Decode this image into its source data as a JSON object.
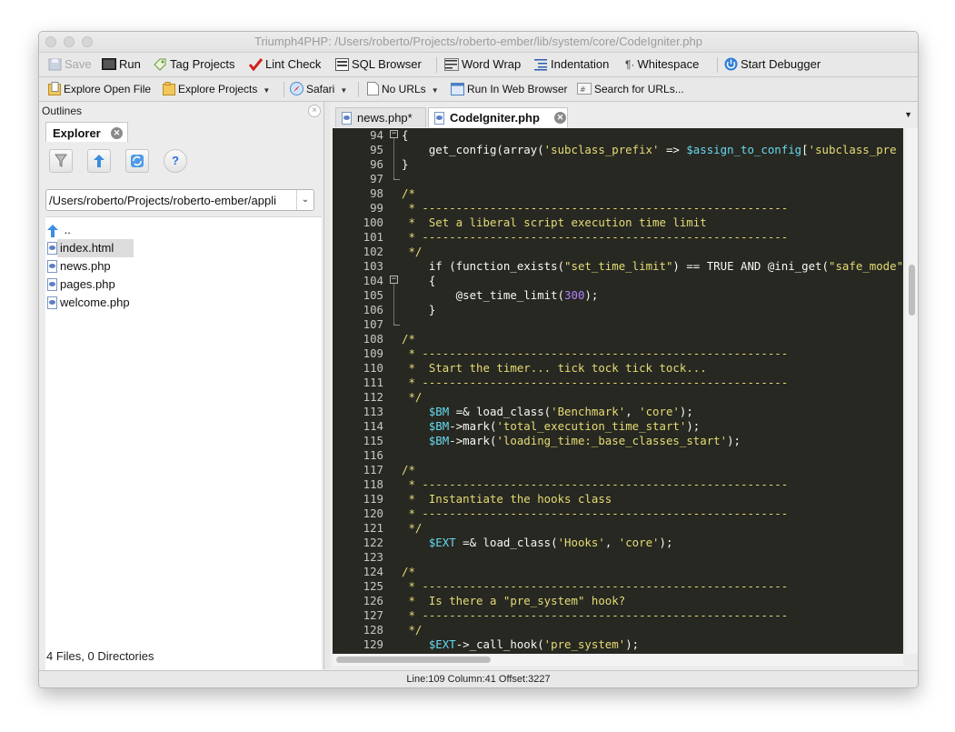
{
  "window": {
    "title": "Triumph4PHP: /Users/roberto/Projects/roberto-ember/lib/system/core/CodeIgniter.php"
  },
  "toolbar1": {
    "save": "Save",
    "run": "Run",
    "tag_projects": "Tag Projects",
    "lint_check": "Lint Check",
    "sql_browser": "SQL Browser",
    "word_wrap": "Word Wrap",
    "indentation": "Indentation",
    "whitespace": "Whitespace",
    "start_debugger": "Start Debugger"
  },
  "toolbar2": {
    "explore_open_file": "Explore Open File",
    "explore_projects": "Explore Projects",
    "browser": "Safari",
    "no_urls": "No URLs",
    "run_in_web_browser": "Run In Web Browser",
    "search_for_urls": "Search for URLs..."
  },
  "left_panel": {
    "header": "Outlines",
    "tab": "Explorer",
    "path": "/Users/roberto/Projects/roberto-ember/appli",
    "parent_dir": "..",
    "files": [
      "index.html",
      "news.php",
      "pages.php",
      "welcome.php"
    ],
    "selected_file": "index.html",
    "status": "4 Files, 0 Directories"
  },
  "editor": {
    "tabs": [
      {
        "label": "news.php*",
        "active": false
      },
      {
        "label": "CodeIgniter.php",
        "active": true
      }
    ],
    "lines": [
      "94",
      "95",
      "96",
      "97",
      "98",
      "99",
      "100",
      "101",
      "102",
      "103",
      "104",
      "105",
      "106",
      "107",
      "108",
      "109",
      "110",
      "111",
      "112",
      "113",
      "114",
      "115",
      "116",
      "117",
      "118",
      "119",
      "120",
      "121",
      "122",
      "123",
      "124",
      "125",
      "126",
      "127",
      "128",
      "129"
    ],
    "code": [
      "{",
      "    get_config(array('subclass_prefix' => $assign_to_config['subclass_pre",
      "}",
      "",
      "/*",
      " * ------------------------------------------------------",
      " *  Set a liberal script execution time limit",
      " * ------------------------------------------------------",
      " */",
      "    if (function_exists(\"set_time_limit\") == TRUE AND @ini_get(\"safe_mode\") =",
      "    {",
      "        @set_time_limit(300);",
      "    }",
      "",
      "/*",
      " * ------------------------------------------------------",
      " *  Start the timer... tick tock tick tock...",
      " * ------------------------------------------------------",
      " */",
      "    $BM =& load_class('Benchmark', 'core');",
      "    $BM->mark('total_execution_time_start');",
      "    $BM->mark('loading_time:_base_classes_start');",
      "",
      "/*",
      " * ------------------------------------------------------",
      " *  Instantiate the hooks class",
      " * ------------------------------------------------------",
      " */",
      "    $EXT =& load_class('Hooks', 'core');",
      "",
      "/*",
      " * ------------------------------------------------------",
      " *  Is there a \"pre_system\" hook?",
      " * ------------------------------------------------------",
      " */",
      "    $EXT->_call_hook('pre_system');"
    ]
  },
  "statusbar": {
    "text": "Line:109 Column:41 Offset:3227"
  }
}
